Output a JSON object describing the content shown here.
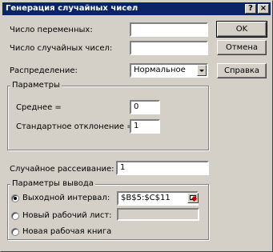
{
  "dialog": {
    "title": "Генерация случайных чисел",
    "help_icon": "?",
    "close_icon": "×"
  },
  "fields": {
    "num_variables_label": "Число переменных:",
    "num_variables_value": "",
    "num_random_label": "Число случайных чисел:",
    "num_random_value": "",
    "distribution_label": "Распределение:",
    "distribution_value": "Нормальное"
  },
  "params": {
    "group_title": "Параметры",
    "mean_label": "Среднее =",
    "mean_value": "0",
    "stddev_label": "Стандартное отклонение =",
    "stddev_value": "1"
  },
  "seed": {
    "label": "Случайное рассеивание:",
    "value": "1"
  },
  "output": {
    "group_title": "Параметры вывода",
    "range_label": "Выходной интервал:",
    "range_value": "$B$5:$C$11",
    "new_sheet_label": "Новый рабочий лист:",
    "new_sheet_value": "",
    "new_book_label": "Новая рабочая книга",
    "selected": "range"
  },
  "buttons": {
    "ok": "OK",
    "cancel": "Отмена",
    "help": "Справка"
  },
  "colors": {
    "titlebar": "#0a246a",
    "face": "#d4d0c8"
  }
}
